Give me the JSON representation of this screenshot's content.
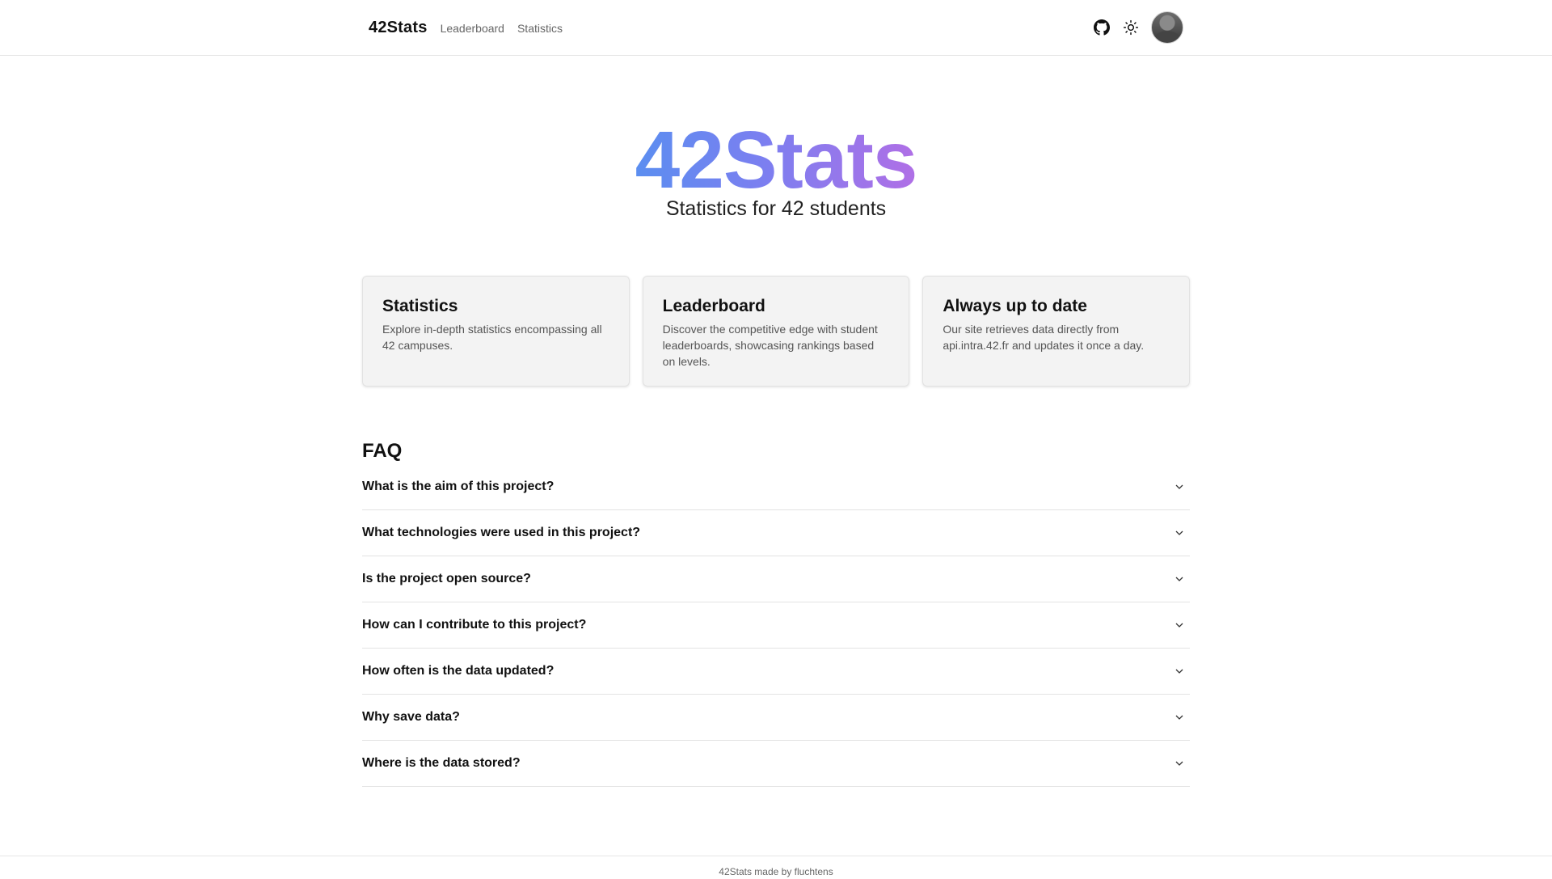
{
  "header": {
    "brand": "42Stats",
    "nav": [
      {
        "label": "Leaderboard"
      },
      {
        "label": "Statistics"
      }
    ],
    "icons": {
      "github": "github-icon",
      "theme": "sun-icon",
      "avatar": "avatar"
    }
  },
  "hero": {
    "title": "42Stats",
    "subtitle": "Statistics for 42 students",
    "gradient": [
      "#5b8ef0",
      "#b06fe6"
    ]
  },
  "cards": [
    {
      "title": "Statistics",
      "text": "Explore in-depth statistics encompassing all 42 campuses."
    },
    {
      "title": "Leaderboard",
      "text": "Discover the competitive edge with student leaderboards, showcasing rankings based on levels."
    },
    {
      "title": "Always up to date",
      "text": "Our site retrieves data directly from api.intra.42.fr and updates it once a day."
    }
  ],
  "faq": {
    "title": "FAQ",
    "items": [
      {
        "question": "What is the aim of this project?"
      },
      {
        "question": "What technologies were used in this project?"
      },
      {
        "question": "Is the project open source?"
      },
      {
        "question": "How can I contribute to this project?"
      },
      {
        "question": "How often is the data updated?"
      },
      {
        "question": "Why save data?"
      },
      {
        "question": "Where is the data stored?"
      }
    ]
  },
  "footer": {
    "text": "42Stats made by fluchtens"
  }
}
